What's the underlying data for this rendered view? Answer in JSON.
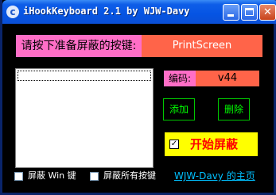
{
  "window": {
    "title": "iHookKeyboard 2.1 by WJW-Davy",
    "controls": [
      "minimize",
      "maximize",
      "close"
    ]
  },
  "prompt": {
    "label": "请按下准备屏蔽的按键:",
    "key_value": "PrintScreen"
  },
  "code": {
    "label": "编码:",
    "value": "v44"
  },
  "buttons": {
    "add": "添加",
    "delete": "删除"
  },
  "start": {
    "label": "开始屏蔽",
    "checked": true,
    "check_mark": "✓"
  },
  "options": {
    "block_win": "屏蔽 Win 键",
    "block_all": "屏蔽所有按键"
  },
  "link": {
    "homepage": "WJW-Davy 的主页"
  },
  "colors": {
    "pink": "#ff6ec7",
    "salmon": "#ff6449",
    "green": "#00ff00",
    "yellow": "#ffff00",
    "link": "#00c0ff"
  }
}
